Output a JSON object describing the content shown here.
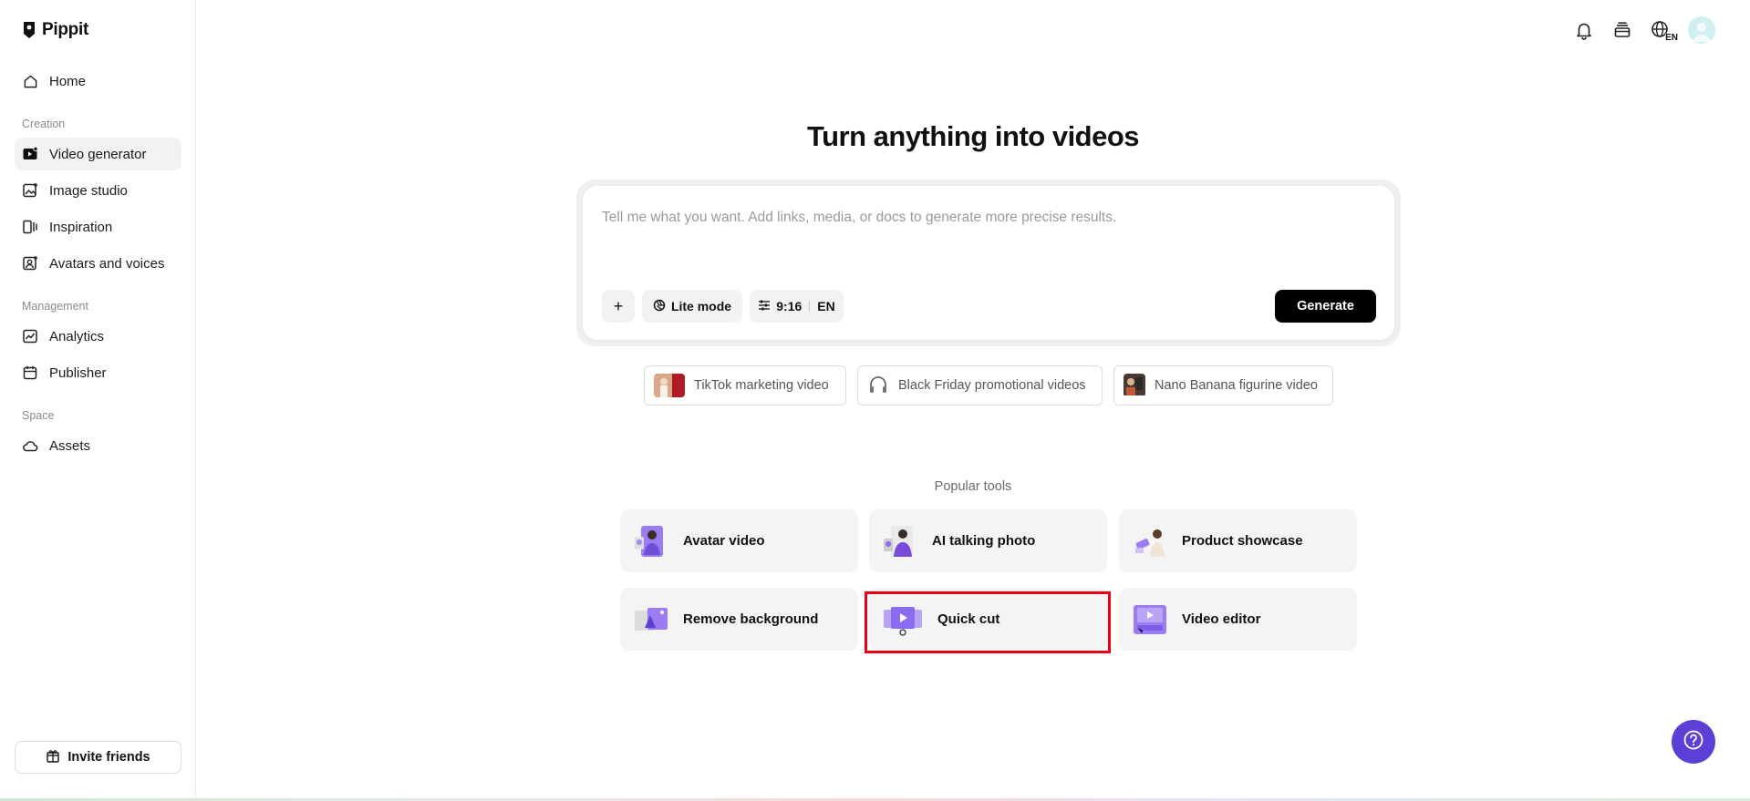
{
  "app": {
    "name": "Pippit"
  },
  "sidebar": {
    "home": "Home",
    "sections": {
      "creation": "Creation",
      "management": "Management",
      "space": "Space"
    },
    "items": [
      {
        "label": "Video generator",
        "active": true
      },
      {
        "label": "Image studio"
      },
      {
        "label": "Inspiration"
      },
      {
        "label": "Avatars and voices"
      },
      {
        "label": "Analytics"
      },
      {
        "label": "Publisher"
      },
      {
        "label": "Assets"
      }
    ],
    "invite_label": "Invite friends"
  },
  "topbar": {
    "language": "EN"
  },
  "main": {
    "headline": "Turn anything into videos",
    "prompt": {
      "placeholder": "Tell me what you want. Add links, media, or docs to generate more precise results.",
      "add_label": "+",
      "mode_label": "Lite mode",
      "ratio_label": "9:16",
      "lang_label": "EN",
      "generate_label": "Generate"
    },
    "suggestions": [
      "TikTok marketing video",
      "Black Friday promotional videos",
      "Nano Banana figurine video"
    ],
    "popular_label": "Popular tools",
    "tools": [
      "Avatar video",
      "AI talking photo",
      "Product showcase",
      "Remove background",
      "Quick cut",
      "Video editor"
    ]
  },
  "colors": {
    "accent": "#5b3fd6",
    "highlight": "#e60012",
    "button": "#000000"
  }
}
